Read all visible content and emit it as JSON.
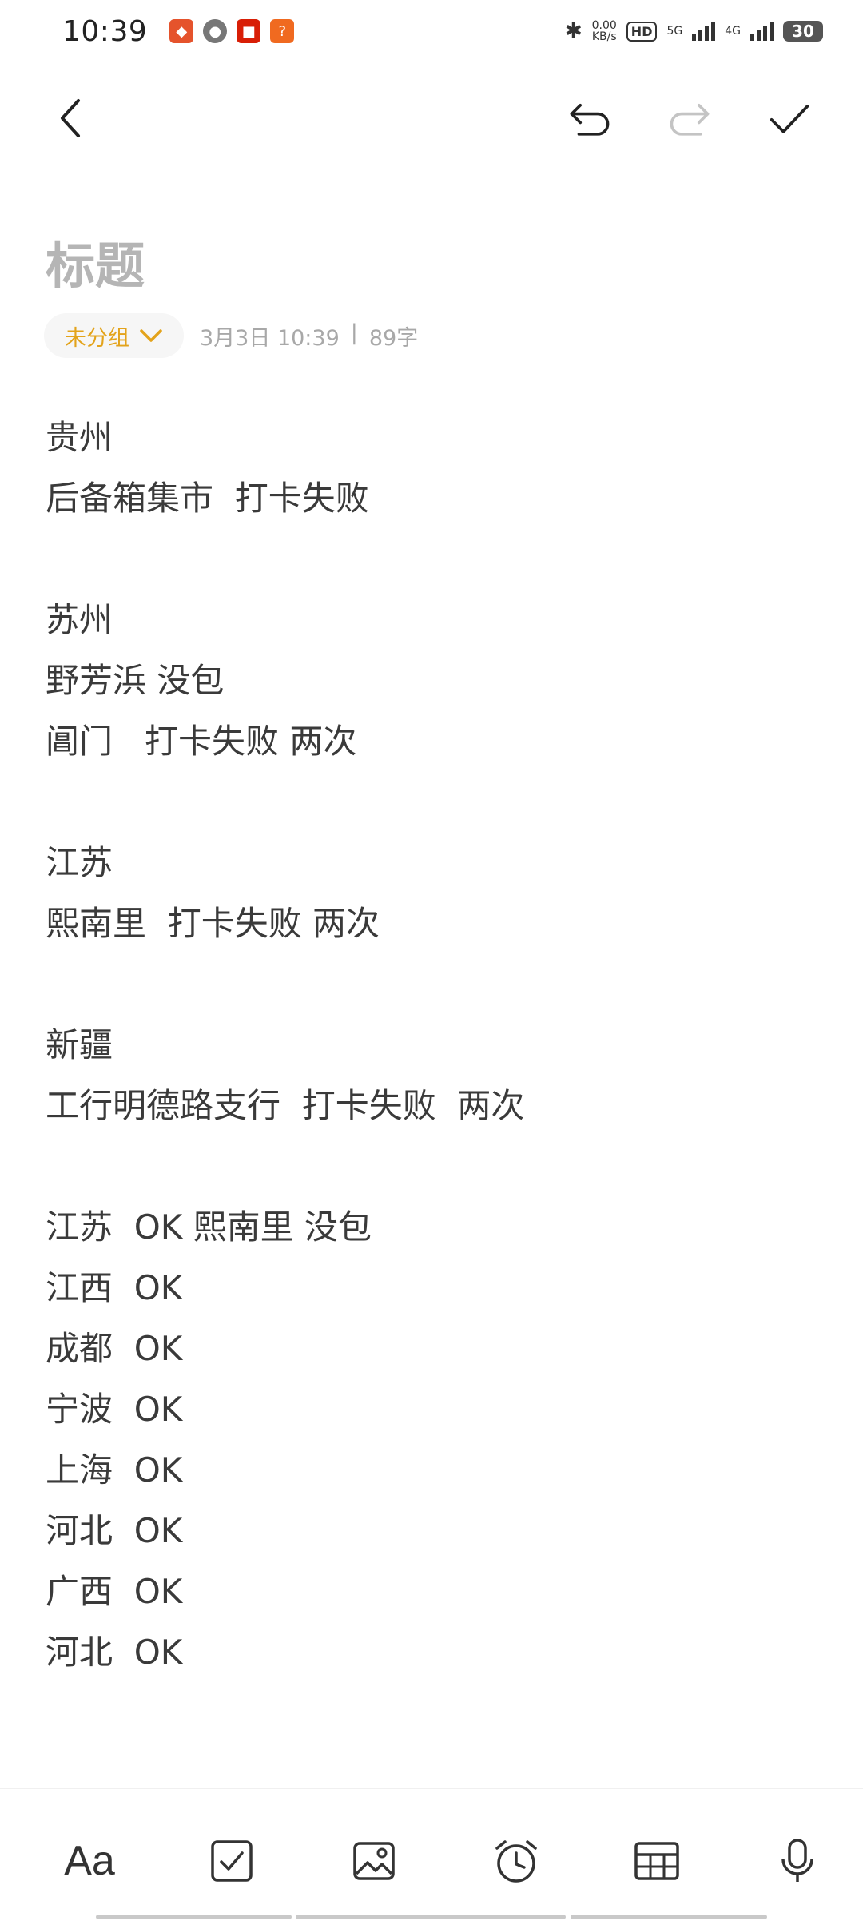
{
  "status_bar": {
    "time": "10:39",
    "network_speed_value": "0.00",
    "network_speed_unit": "KB/s",
    "hd_label": "HD",
    "sim1_label": "5G",
    "sim2_label": "4G",
    "battery": "30"
  },
  "toolbar": {
    "back_icon": "chevron-left-icon",
    "undo_icon": "undo-icon",
    "redo_icon": "redo-icon",
    "done_icon": "check-icon"
  },
  "note": {
    "title_placeholder": "标题",
    "group_label": "未分组",
    "date": "3月3日 10:39",
    "separator": "|",
    "char_count": "89字",
    "lines": [
      "贵州",
      "后备箱集市  打卡失败",
      "",
      "苏州",
      "野芳浜 没包",
      "阊门   打卡失败 两次",
      "",
      "江苏",
      "熙南里  打卡失败 两次",
      "",
      "新疆",
      "工行明德路支行  打卡失败  两次",
      "",
      "江苏  OK 熙南里 没包",
      "江西  OK",
      "成都  OK",
      "宁波  OK",
      "上海  OK",
      "河北  OK",
      "广西  OK",
      "河北  OK"
    ]
  },
  "bottom_toolbar": {
    "font_label": "Aa",
    "items": [
      "font-style-icon",
      "checklist-icon",
      "image-icon",
      "alarm-icon",
      "table-icon",
      "microphone-icon"
    ]
  }
}
